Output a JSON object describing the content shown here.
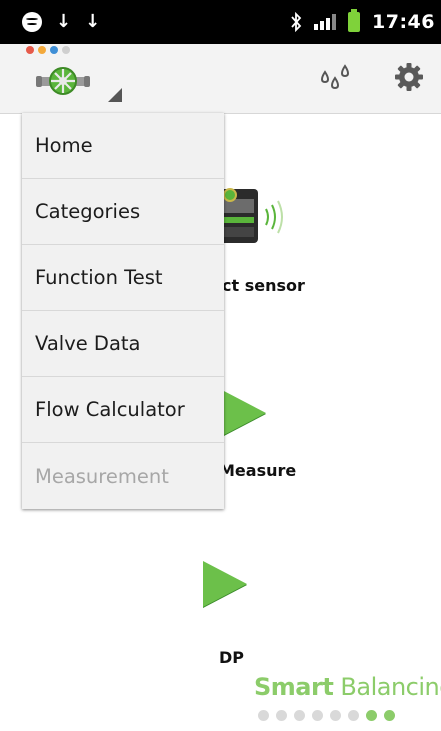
{
  "status_bar": {
    "time": "17:46",
    "download_glyph": "↓"
  },
  "action_bar": {
    "app_icon": "valve-logo-icon",
    "action_icons": [
      "water-drops-icon",
      "gear-icon"
    ],
    "dot_colors": [
      "#e65a4a",
      "#f3a93b",
      "#3f8fd6",
      "#cfcfcf"
    ]
  },
  "dropdown": {
    "items": [
      {
        "label": "Home",
        "enabled": true
      },
      {
        "label": "Categories",
        "enabled": true
      },
      {
        "label": "Function Test",
        "enabled": true
      },
      {
        "label": "Valve Data",
        "enabled": true
      },
      {
        "label": "Flow Calculator",
        "enabled": true
      },
      {
        "label": "Measurement",
        "enabled": false
      }
    ]
  },
  "content": {
    "items": [
      {
        "label": "ct sensor",
        "icon": "sensor-device-icon"
      },
      {
        "label": "Measure",
        "icon": "play-icon"
      },
      {
        "label": "DP",
        "icon": "play-icon"
      }
    ]
  },
  "brand": {
    "bold": "Smart",
    "light": " Balancing"
  },
  "pager": {
    "total": 8,
    "active": [
      6,
      7
    ],
    "color_active": "#8ccc6a"
  }
}
